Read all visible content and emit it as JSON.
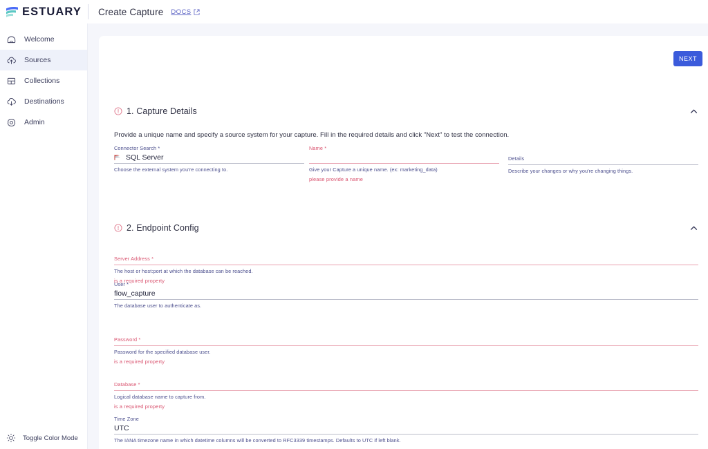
{
  "brand": {
    "logo_text": "ESTUARY",
    "logo_colors": {
      "wave_blue": "#4a6cf7",
      "wave_teal": "#5bc8c4"
    }
  },
  "topbar": {
    "page_title": "Create Capture",
    "docs_label": "DOCS",
    "docs_icon": "external-link-icon"
  },
  "sidebar": {
    "items": [
      {
        "label": "Welcome",
        "icon": "home-icon",
        "active": false
      },
      {
        "label": "Sources",
        "icon": "cloud-upload-icon",
        "active": true
      },
      {
        "label": "Collections",
        "icon": "collections-icon",
        "active": false
      },
      {
        "label": "Destinations",
        "icon": "cloud-download-icon",
        "active": false
      },
      {
        "label": "Admin",
        "icon": "gear-icon",
        "active": false
      }
    ],
    "color_mode": {
      "label": "Toggle Color Mode",
      "icon": "sun-icon"
    }
  },
  "toolbar": {
    "next_label": "NEXT",
    "next_color": "#3b5bdb"
  },
  "sections": [
    {
      "title": "1. Capture Details",
      "icon": "alert-circle-icon",
      "collapse_icon": "chevron-up-icon",
      "description": "Provide a unique name and specify a source system for your capture. Fill in the required details and click \"Next\" to test the connection."
    },
    {
      "title": "2. Endpoint Config",
      "icon": "alert-circle-icon",
      "collapse_icon": "chevron-up-icon"
    }
  ],
  "fields": {
    "connector_search": {
      "label": "Connector Search *",
      "value": "SQL Server",
      "icon": "sql-server-icon",
      "help": "Choose the external system you're connecting to.",
      "error": "",
      "state": "filled"
    },
    "name": {
      "label": "Name *",
      "value": "",
      "help": "Give your Capture a unique name. (ex: marketing_data)",
      "error": "please provide a name",
      "state": "error"
    },
    "details": {
      "label": "Details",
      "value": "",
      "help": "Describe your changes or why you're changing things.",
      "error": "",
      "state": "empty"
    },
    "server_address": {
      "label": "Server Address *",
      "value": "",
      "help": "The host or host:port at which the database can be reached.",
      "error": "is a required property",
      "state": "error"
    },
    "user": {
      "label": "User *",
      "value": "flow_capture",
      "help": "The database user to authenticate as.",
      "error": "",
      "state": "filled"
    },
    "password": {
      "label": "Password *",
      "value": "",
      "help": "Password for the specified database user.",
      "error": "is a required property",
      "state": "error"
    },
    "database": {
      "label": "Database *",
      "value": "",
      "help": "Logical database name to capture from.",
      "error": "is a required property",
      "state": "error"
    },
    "time_zone": {
      "label": "Time Zone",
      "value": "UTC",
      "help": "The IANA timezone name in which datetime columns will be converted to RFC3339 timestamps. Defaults to UTC if left blank.",
      "error": "",
      "state": "filled"
    }
  },
  "colors": {
    "accent_blue": "#3b5bdb",
    "error_red": "#d9536f",
    "label_purple": "#4a4d8c",
    "page_bg": "#f5f6fb",
    "active_nav_bg": "#eef1fa"
  }
}
